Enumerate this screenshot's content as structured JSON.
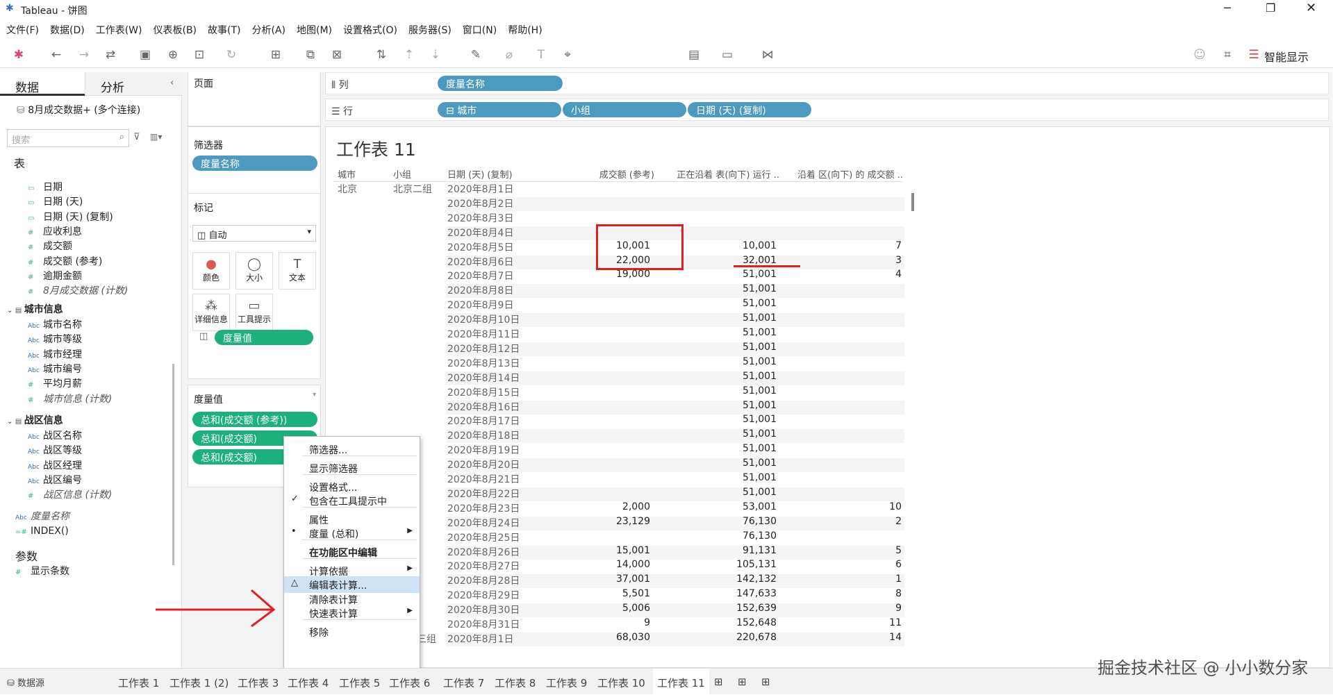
{
  "window": {
    "title": "Tableau - 饼图"
  },
  "menu": [
    "文件(F)",
    "数据(D)",
    "工作表(W)",
    "仪表板(B)",
    "故事(T)",
    "分析(A)",
    "地图(M)",
    "设置格式(O)",
    "服务器(S)",
    "窗口(N)",
    "帮助(H)"
  ],
  "toolbar": {
    "fit_select": "标准",
    "show_me": "智能显示"
  },
  "left": {
    "tab_data": "数据",
    "tab_analysis": "分析",
    "datasource": "8月成交数据+ (多个连接)",
    "search_placeholder": "搜索",
    "table_header": "表",
    "fields": [
      {
        "name": "日期",
        "type": "date",
        "italic": false
      },
      {
        "name": "日期 (天)",
        "type": "date",
        "italic": false
      },
      {
        "name": "日期 (天) (复制)",
        "type": "date",
        "italic": false
      },
      {
        "name": "应收利息",
        "type": "num",
        "italic": false
      },
      {
        "name": "成交额",
        "type": "num",
        "italic": false
      },
      {
        "name": "成交额 (参考)",
        "type": "num",
        "italic": false
      },
      {
        "name": "逾期金额",
        "type": "num",
        "italic": false
      },
      {
        "name": "8月成交数据 (计数)",
        "type": "num",
        "italic": true
      }
    ],
    "group_city": "城市信息",
    "city_fields": [
      {
        "name": "城市名称",
        "type": "abc",
        "italic": false
      },
      {
        "name": "城市等级",
        "type": "abc",
        "italic": false
      },
      {
        "name": "城市经理",
        "type": "abc",
        "italic": false
      },
      {
        "name": "城市编号",
        "type": "abc",
        "italic": false
      },
      {
        "name": "平均月薪",
        "type": "num",
        "italic": false
      },
      {
        "name": "城市信息 (计数)",
        "type": "num",
        "italic": true
      }
    ],
    "group_zone": "战区信息",
    "zone_fields": [
      {
        "name": "战区名称",
        "type": "abc",
        "italic": false
      },
      {
        "name": "战区等级",
        "type": "abc",
        "italic": false
      },
      {
        "name": "战区经理",
        "type": "abc",
        "italic": false
      },
      {
        "name": "战区编号",
        "type": "abc",
        "italic": false
      },
      {
        "name": "战区信息 (计数)",
        "type": "num",
        "italic": true
      }
    ],
    "measure_names": "度量名称",
    "index_field": "INDEX()",
    "params_header": "参数",
    "param_item": "显示条数"
  },
  "shelves": {
    "pages": "页面",
    "filters": "筛选器",
    "filter_pill": "度量名称",
    "marks": "标记",
    "marks_type": "自动",
    "mark_btns": [
      "颜色",
      "大小",
      "文本",
      "详细信息",
      "工具提示"
    ],
    "text_pill": "度量值",
    "measure_values": "度量值",
    "mv_pills": [
      "总和(成交额 (参考))",
      "总和(成交额)",
      "总和(成交额)"
    ]
  },
  "columns": {
    "label": "列",
    "pills": [
      "度量名称"
    ]
  },
  "rows": {
    "label": "行",
    "pills": [
      "城市",
      "小组",
      "日期 (天) (复制)"
    ]
  },
  "sheet": {
    "title": "工作表 11",
    "headers": [
      "城市",
      "小组",
      "日期 (天) (复制)",
      "成交额 (参考)",
      "正在沿着 表(向下) 运行 ..",
      "沿着 区(向下) 的 成交额 .."
    ],
    "city": "北京",
    "group": "北京二组",
    "rows": [
      [
        "2020年8月1日",
        "",
        "",
        ""
      ],
      [
        "2020年8月2日",
        "",
        "",
        ""
      ],
      [
        "2020年8月3日",
        "",
        "",
        ""
      ],
      [
        "2020年8月4日",
        "",
        "",
        ""
      ],
      [
        "2020年8月5日",
        "10,001",
        "10,001",
        "7"
      ],
      [
        "2020年8月6日",
        "22,000",
        "32,001",
        "3"
      ],
      [
        "2020年8月7日",
        "19,000",
        "51,001",
        "4"
      ],
      [
        "2020年8月8日",
        "",
        "51,001",
        ""
      ],
      [
        "2020年8月9日",
        "",
        "51,001",
        ""
      ],
      [
        "2020年8月10日",
        "",
        "51,001",
        ""
      ],
      [
        "2020年8月11日",
        "",
        "51,001",
        ""
      ],
      [
        "2020年8月12日",
        "",
        "51,001",
        ""
      ],
      [
        "2020年8月13日",
        "",
        "51,001",
        ""
      ],
      [
        "2020年8月14日",
        "",
        "51,001",
        ""
      ],
      [
        "2020年8月15日",
        "",
        "51,001",
        ""
      ],
      [
        "2020年8月16日",
        "",
        "51,001",
        ""
      ],
      [
        "2020年8月17日",
        "",
        "51,001",
        ""
      ],
      [
        "2020年8月18日",
        "",
        "51,001",
        ""
      ],
      [
        "2020年8月19日",
        "",
        "51,001",
        ""
      ],
      [
        "2020年8月20日",
        "",
        "51,001",
        ""
      ],
      [
        "2020年8月21日",
        "",
        "51,001",
        ""
      ],
      [
        "2020年8月22日",
        "",
        "51,001",
        ""
      ],
      [
        "2020年8月23日",
        "2,000",
        "53,001",
        "10"
      ],
      [
        "2020年8月24日",
        "23,129",
        "76,130",
        "2"
      ],
      [
        "2020年8月25日",
        "",
        "76,130",
        ""
      ],
      [
        "2020年8月26日",
        "15,001",
        "91,131",
        "5"
      ],
      [
        "2020年8月27日",
        "14,000",
        "105,131",
        "6"
      ],
      [
        "2020年8月28日",
        "37,001",
        "142,132",
        "1"
      ],
      [
        "2020年8月29日",
        "5,501",
        "147,633",
        "8"
      ],
      [
        "2020年8月30日",
        "5,006",
        "152,639",
        "9"
      ],
      [
        "2020年8月31日",
        "9",
        "152,648",
        "11"
      ],
      [
        "2020年8月1日",
        "68,030",
        "220,678",
        "14"
      ]
    ],
    "last_group_partial": "三组"
  },
  "context_menu": [
    {
      "label": "筛选器...",
      "mark": "",
      "sub": false,
      "hl": false,
      "bold": false
    },
    {
      "label": "显示筛选器",
      "mark": "",
      "sub": false,
      "hl": false,
      "bold": false
    },
    {
      "label": "设置格式...",
      "mark": "",
      "sub": false,
      "hl": false,
      "bold": false
    },
    {
      "label": "包含在工具提示中",
      "mark": "✓",
      "sub": false,
      "hl": false,
      "bold": false
    },
    {
      "label": "属性",
      "mark": "",
      "sub": false,
      "hl": false,
      "bold": false
    },
    {
      "label": "度量 (总和)",
      "mark": "•",
      "sub": true,
      "hl": false,
      "bold": false
    },
    {
      "label": "在功能区中编辑",
      "mark": "",
      "sub": false,
      "hl": false,
      "bold": true
    },
    {
      "label": "计算依据",
      "mark": "",
      "sub": true,
      "hl": false,
      "bold": false
    },
    {
      "label": "编辑表计算...",
      "mark": "△",
      "sub": false,
      "hl": true,
      "bold": false
    },
    {
      "label": "清除表计算",
      "mark": "",
      "sub": false,
      "hl": false,
      "bold": false
    },
    {
      "label": "快速表计算",
      "mark": "",
      "sub": true,
      "hl": false,
      "bold": false
    },
    {
      "label": "移除",
      "mark": "",
      "sub": false,
      "hl": false,
      "bold": false
    }
  ],
  "tabs": {
    "datasource": "数据源",
    "sheets": [
      "工作表 1",
      "工作表 1 (2)",
      "工作表 3",
      "工作表 4",
      "工作表 5",
      "工作表 6",
      "工作表 7",
      "工作表 8",
      "工作表 9",
      "工作表 10",
      "工作表 11"
    ],
    "active": "工作表 11"
  },
  "watermark": "掘金技术社区 @ 小小数分家",
  "colors": {
    "green_pill": "#1bb07c",
    "blue_pill": "#4d9ac1",
    "annotation": "#e02020",
    "highlight": "#cfe3f5"
  }
}
